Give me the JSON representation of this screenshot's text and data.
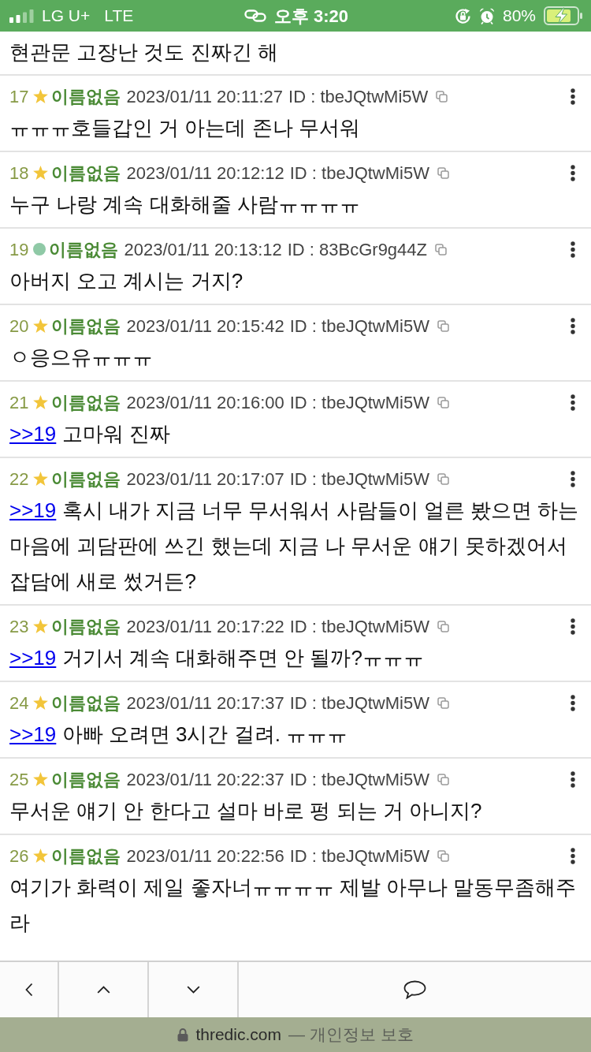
{
  "status_bar": {
    "carrier": "LG U+",
    "network": "LTE",
    "time": "오후 3:20",
    "battery": "80%"
  },
  "thread": {
    "continued_text": "현관문 고장난 것도 진짜긴 해",
    "posts": [
      {
        "number": "17",
        "marker": {
          "kind": "star"
        },
        "name": "이름없음",
        "date": "2023/01/11 20:11:27",
        "id": "ID : tbeJQtwMi5W",
        "text": "ㅠㅠㅠ호들갑인 거 아는데 존나 무서워"
      },
      {
        "number": "18",
        "marker": {
          "kind": "star"
        },
        "name": "이름없음",
        "date": "2023/01/11 20:12:12",
        "id": "ID : tbeJQtwMi5W",
        "text": "누구 나랑 계속 대화해줄 사람ㅠㅠㅠㅠ"
      },
      {
        "number": "19",
        "marker": {
          "kind": "dot"
        },
        "name": "이름없음",
        "date": "2023/01/11 20:13:12",
        "id": "ID : 83BcGr9g44Z",
        "text": "아버지 오고 계시는 거지?"
      },
      {
        "number": "20",
        "marker": {
          "kind": "star"
        },
        "name": "이름없음",
        "date": "2023/01/11 20:15:42",
        "id": "ID : tbeJQtwMi5W",
        "text": "ㅇ응으유ㅠㅠㅠ"
      },
      {
        "number": "21",
        "marker": {
          "kind": "star"
        },
        "name": "이름없음",
        "date": "2023/01/11 20:16:00",
        "id": "ID : tbeJQtwMi5W",
        "reply_to": ">>19",
        "text": "고마워 진짜"
      },
      {
        "number": "22",
        "marker": {
          "kind": "star"
        },
        "name": "이름없음",
        "date": "2023/01/11 20:17:07",
        "id": "ID : tbeJQtwMi5W",
        "reply_to": ">>19",
        "text": "혹시 내가 지금 너무 무서워서 사람들이 얼른 봤으면 하는 마음에 괴담판에 쓰긴 했는데 지금 나 무서운 얘기 못하겠어서 잡담에 새로 썼거든?"
      },
      {
        "number": "23",
        "marker": {
          "kind": "star"
        },
        "name": "이름없음",
        "date": "2023/01/11 20:17:22",
        "id": "ID : tbeJQtwMi5W",
        "reply_to": ">>19",
        "text": "거기서 계속 대화해주면 안 될까?ㅠㅠㅠ"
      },
      {
        "number": "24",
        "marker": {
          "kind": "star"
        },
        "name": "이름없음",
        "date": "2023/01/11 20:17:37",
        "id": "ID : tbeJQtwMi5W",
        "reply_to": ">>19",
        "text": "아빠 오려면 3시간 걸려. ㅠㅠㅠ"
      },
      {
        "number": "25",
        "marker": {
          "kind": "star"
        },
        "name": "이름없음",
        "date": "2023/01/11 20:22:37",
        "id": "ID : tbeJQtwMi5W",
        "text": "무서운 얘기 안 한다고 설마 바로 펑 되는 거 아니지?"
      },
      {
        "number": "26",
        "marker": {
          "kind": "star"
        },
        "name": "이름없음",
        "date": "2023/01/11 20:22:56",
        "id": "ID : tbeJQtwMi5W",
        "text": "여기가 화력이 제일 좋자너ㅠㅠㅠㅠ 제발 아무나 말동무좀해주라"
      }
    ]
  },
  "toolbar": {
    "buttons": [
      {
        "kind": "back"
      },
      {
        "kind": "up"
      },
      {
        "kind": "down"
      },
      {
        "kind": "comment"
      }
    ]
  },
  "address_bar": {
    "domain": "thredic.com",
    "note": "— 개인정보 보호"
  }
}
